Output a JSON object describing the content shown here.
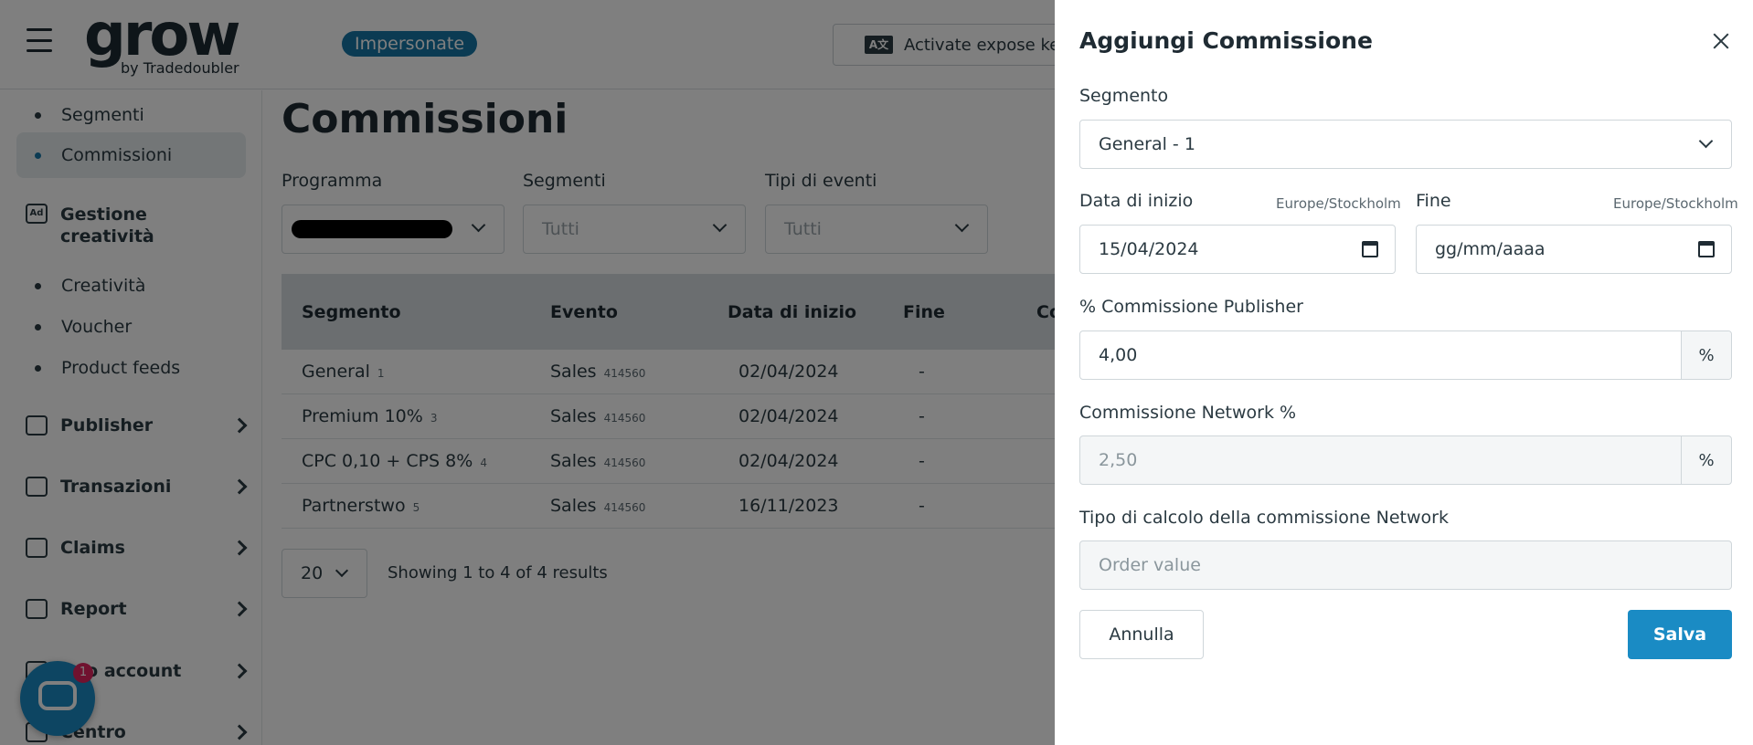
{
  "topbar": {
    "logo_word": "grow",
    "logo_sub": "by Tradedoubler",
    "impersonate_label": "Impersonate",
    "expose_label": "Activate expose key"
  },
  "sidebar": {
    "sub_top": [
      {
        "label": "Segmenti"
      },
      {
        "label": "Commissioni"
      }
    ],
    "creative_group": {
      "label_line1": "Gestione",
      "label_line2": "creatività"
    },
    "sub_creative": [
      {
        "label": "Creatività"
      },
      {
        "label": "Voucher"
      },
      {
        "label": "Product feeds"
      }
    ],
    "nav": [
      {
        "label": "Publisher"
      },
      {
        "label": "Transazioni"
      },
      {
        "label": "Claims"
      },
      {
        "label": "Report"
      },
      {
        "label": "...io account"
      },
      {
        "label": "Centro"
      }
    ]
  },
  "main": {
    "title": "Commissioni",
    "filters": {
      "programma_label": "Programma",
      "segmenti_label": "Segmenti",
      "segmenti_value": "Tutti",
      "eventi_label": "Tipi di eventi",
      "eventi_value": "Tutti"
    },
    "table": {
      "headers": [
        "Segmento",
        "Evento",
        "Data di inizio",
        "Fine",
        "Co"
      ],
      "rows": [
        {
          "segment": "General",
          "seg_id": "1",
          "event": "Sales",
          "event_id": "414560",
          "start": "02/04/2024",
          "end": "-"
        },
        {
          "segment": "Premium 10%",
          "seg_id": "3",
          "event": "Sales",
          "event_id": "414560",
          "start": "02/04/2024",
          "end": "-"
        },
        {
          "segment": "CPC 0,10 + CPS 8%",
          "seg_id": "4",
          "event": "Sales",
          "event_id": "414560",
          "start": "02/04/2024",
          "end": "-"
        },
        {
          "segment": "Partnerstwo",
          "seg_id": "5",
          "event": "Sales",
          "event_id": "414560",
          "start": "16/11/2023",
          "end": "-"
        }
      ]
    },
    "pager_value": "20",
    "results_text": "Showing 1 to 4 of 4 results"
  },
  "chat": {
    "badge": "1"
  },
  "drawer": {
    "title": "Aggiungi Commissione",
    "segment_label": "Segmento",
    "segment_value": "General - 1",
    "start_label": "Data di inizio",
    "start_tz": "Europe/Stockholm",
    "start_value": "15/04/2024",
    "end_label": "Fine",
    "end_tz": "Europe/Stockholm",
    "end_placeholder": "gg/mm/aaaa",
    "publisher_label": "% Commissione Publisher",
    "publisher_value": "4,00",
    "publisher_suffix": "%",
    "network_label": "Commissione Network %",
    "network_value": "2,50",
    "network_suffix": "%",
    "calc_label": "Tipo di calcolo della commissione Network",
    "calc_value": "Order value",
    "cancel_label": "Annulla",
    "save_label": "Salva"
  },
  "colors": {
    "accent": "#1a8bc4",
    "badge": "#1676a6",
    "overlay": "rgba(0,0,0,0.5)"
  }
}
